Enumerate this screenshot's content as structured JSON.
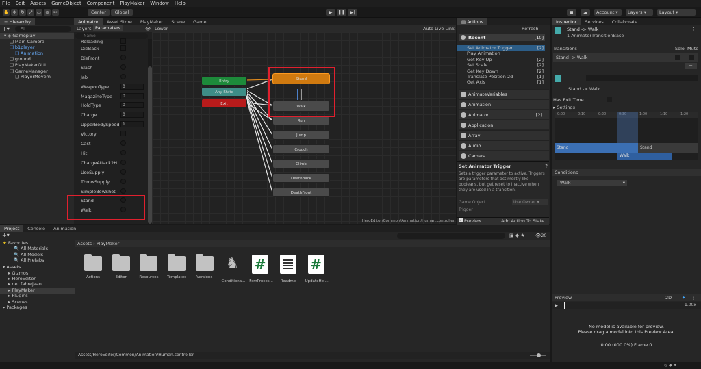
{
  "menu": [
    "File",
    "Edit",
    "Assets",
    "GameObject",
    "Component",
    "PlayMaker",
    "Window",
    "Help"
  ],
  "toolbar": {
    "center": "Center",
    "global": "Global",
    "account": "Account",
    "layers": "Layers",
    "layout": "Layout"
  },
  "hierarchy": {
    "tab": "Hierarchy",
    "search": "All",
    "items": [
      {
        "label": "Gameplay",
        "indent": 0
      },
      {
        "label": "Main Camera",
        "indent": 1
      },
      {
        "label": "b1player",
        "indent": 1
      },
      {
        "label": "Animation",
        "indent": 2
      },
      {
        "label": "ground",
        "indent": 1
      },
      {
        "label": "PlayMakerGUI",
        "indent": 1
      },
      {
        "label": "GameManager",
        "indent": 1
      },
      {
        "label": "PlayerMovem",
        "indent": 2
      }
    ]
  },
  "animator": {
    "tabs": [
      "Animator",
      "Asset Store",
      "PlayMaker",
      "Scene",
      "Game"
    ],
    "layers_tab": "Layers",
    "parameters_tab": "Parameters",
    "lower": "Lower",
    "auto_live": "Auto Live Link",
    "search_placeholder": "Name",
    "params": [
      {
        "name": "Reloading",
        "type": "bool"
      },
      {
        "name": "DieBack",
        "type": "bool"
      },
      {
        "name": "DieFront",
        "type": "trigger"
      },
      {
        "name": "Slash",
        "type": "trigger"
      },
      {
        "name": "Jab",
        "type": "trigger"
      },
      {
        "name": "WeaponType",
        "type": "int",
        "value": "0"
      },
      {
        "name": "MagazineType",
        "type": "int",
        "value": "0"
      },
      {
        "name": "HoldType",
        "type": "int",
        "value": "0"
      },
      {
        "name": "Charge",
        "type": "int",
        "value": "0"
      },
      {
        "name": "UpperBodySpeed",
        "type": "int",
        "value": "1"
      },
      {
        "name": "Victory",
        "type": "bool"
      },
      {
        "name": "Cast",
        "type": "trigger"
      },
      {
        "name": "Hit",
        "type": "trigger"
      },
      {
        "name": "ChargeAttack2H",
        "type": "trigger"
      },
      {
        "name": "UseSupply",
        "type": "trigger"
      },
      {
        "name": "ThrowSupply",
        "type": "trigger"
      },
      {
        "name": "SimpleBowShot",
        "type": "trigger"
      },
      {
        "name": "Stand",
        "type": "trigger"
      },
      {
        "name": "Walk",
        "type": "trigger"
      }
    ],
    "states": {
      "entry": "Entry",
      "any": "Any State",
      "exit": "Exit",
      "stand": "Stand",
      "walk": "Walk",
      "run": "Run",
      "jump": "Jump",
      "crouch": "Crouch",
      "climb": "Climb",
      "deathback": "DeathBack",
      "deathfront": "DeathFront"
    },
    "footer": "HeroEditor/Common/Animation/Human.controller"
  },
  "actions": {
    "tab": "Actions",
    "refresh": "Refresh",
    "recent": "Recent",
    "recent_count": "[10]",
    "recent_items": [
      {
        "label": "Set Animator Trigger",
        "count": "[2]"
      },
      {
        "label": "Play Animation",
        "count": ""
      },
      {
        "label": "Get Key Up",
        "count": "[2]"
      },
      {
        "label": "Set Scale",
        "count": "[2]"
      },
      {
        "label": "Get Key Down",
        "count": "[2]"
      },
      {
        "label": "Translate Position 2d",
        "count": "[1]"
      },
      {
        "label": "Get Axis",
        "count": "[1]"
      }
    ],
    "categories": [
      {
        "label": "AnimateVariables",
        "count": ""
      },
      {
        "label": "Animation",
        "count": ""
      },
      {
        "label": "Animator",
        "count": "[2]"
      },
      {
        "label": "Application",
        "count": ""
      },
      {
        "label": "Array",
        "count": ""
      },
      {
        "label": "Audio",
        "count": ""
      },
      {
        "label": "Camera",
        "count": ""
      }
    ],
    "desc_title": "Set Animator Trigger",
    "desc_text": "Sets a trigger parameter to active. Triggers are parameters that act mostly like booleans, but get reset to inactive when they are used in a transition.",
    "game_object": "Game Object",
    "use_owner": "Use Owner",
    "trigger": "Trigger",
    "preview": "Preview",
    "add_action": "Add Action To State"
  },
  "inspector": {
    "tabs": [
      "Inspector",
      "Services",
      "Collaborate"
    ],
    "title": "Stand -> Walk",
    "subtitle": "1 AnimatorTransitionBase",
    "transitions": "Transitions",
    "solo": "Solo",
    "mute": "Mute",
    "transition_item": "Stand -> Walk",
    "sub_title": "Stand -> Walk",
    "has_exit_time": "Has Exit Time",
    "settings": "Settings",
    "timeline_ticks": [
      "0:00",
      "0:10",
      "0:20",
      "0:30",
      "1:00",
      "1:10",
      "1:20"
    ],
    "timeline_stand": "Stand",
    "timeline_stand2": "Stand",
    "timeline_walk": "Walk",
    "conditions": "Conditions",
    "condition_value": "Walk",
    "preview": "Preview",
    "preview_2d": "2D",
    "speed": "1.00x",
    "no_model_1": "No model is available for preview.",
    "no_model_2": "Please drag a model into this Preview Area.",
    "frame": "0:00 (000.0%) Frame 0"
  },
  "project": {
    "tabs": [
      "Project",
      "Console",
      "Animation"
    ],
    "favorites": "Favorites",
    "fav_items": [
      "All Materials",
      "All Models",
      "All Prefabs"
    ],
    "assets": "Assets",
    "asset_items": [
      "Gizmos",
      "HeroEditor",
      "net.fabrejean",
      "PlayMaker",
      "Plugins",
      "Scenes"
    ],
    "packages": "Packages",
    "breadcrumb_root": "Assets",
    "breadcrumb_leaf": "PlayMaker",
    "count": "20",
    "files": [
      {
        "label": "Actions",
        "kind": "folder"
      },
      {
        "label": "Editor",
        "kind": "folder"
      },
      {
        "label": "Resources",
        "kind": "folder"
      },
      {
        "label": "Templates",
        "kind": "folder"
      },
      {
        "label": "Versions",
        "kind": "folder"
      },
      {
        "label": "Conditiona...",
        "kind": "puzzle"
      },
      {
        "label": "FsmProces...",
        "kind": "script"
      },
      {
        "label": "Readme",
        "kind": "doc"
      },
      {
        "label": "UpdateHel...",
        "kind": "script"
      }
    ],
    "footer_path": "Assets/HeroEditor/Common/Animation/Human.controller"
  }
}
